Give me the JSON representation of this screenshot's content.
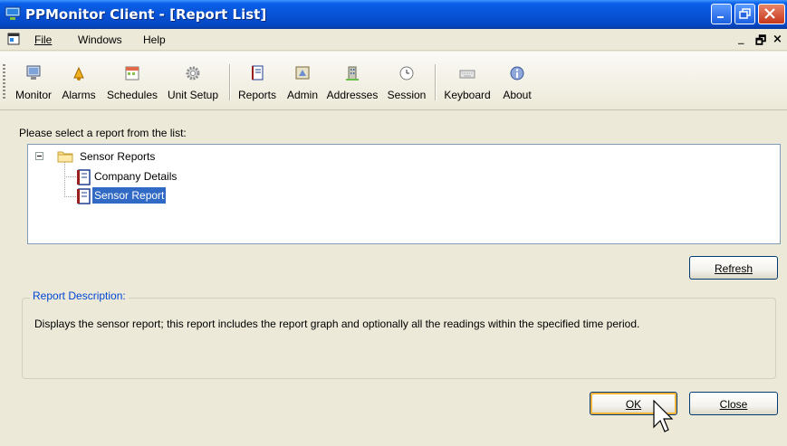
{
  "window": {
    "title": "PPMonitor Client - [Report List]"
  },
  "menubar": {
    "items": [
      "File",
      "Windows",
      "Help"
    ],
    "mdi_minimize": "_",
    "mdi_restore": "🗗",
    "mdi_close": "×"
  },
  "toolbar": {
    "buttons": [
      {
        "label": "Monitor",
        "icon": "monitor-icon"
      },
      {
        "label": "Alarms",
        "icon": "alarm-bell-icon"
      },
      {
        "label": "Schedules",
        "icon": "calendar-icon"
      },
      {
        "label": "Unit Setup",
        "icon": "gear-icon"
      },
      {
        "label": "Reports",
        "icon": "report-icon"
      },
      {
        "label": "Admin",
        "icon": "admin-icon"
      },
      {
        "label": "Addresses",
        "icon": "building-icon"
      },
      {
        "label": "Session",
        "icon": "clock-icon"
      },
      {
        "label": "Keyboard",
        "icon": "keyboard-icon"
      },
      {
        "label": "About",
        "icon": "info-icon"
      }
    ]
  },
  "main": {
    "prompt": "Please select a report from the list:",
    "tree": {
      "root": "Sensor Reports",
      "children": [
        {
          "label": "Company Details",
          "selected": false
        },
        {
          "label": "Sensor Report",
          "selected": true
        }
      ]
    },
    "refresh_label": "Refresh",
    "description_title": "Report Description:",
    "description_text": "Displays the sensor report; this report includes the report graph and optionally all the readings within the specified time period.",
    "ok_label": "OK",
    "close_label": "Close"
  },
  "colors": {
    "title_bar": "#0753d6",
    "selection": "#316ac5",
    "group_title": "#0046d5",
    "background": "#ece9d8"
  }
}
